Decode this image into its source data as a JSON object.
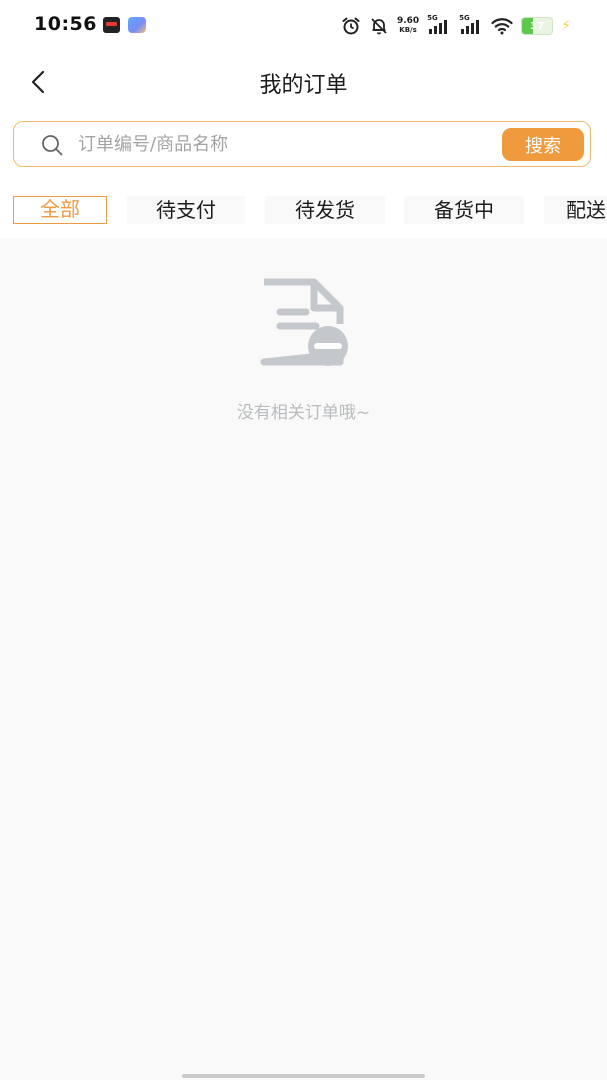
{
  "status_bar": {
    "time": "10:56",
    "net_speed_value": "9.60",
    "net_speed_unit": "KB/s",
    "signal_1_label": "5G",
    "signal_2_label": "5G",
    "battery_level": "37",
    "battery_fraction": 0.37,
    "colors": {
      "battery_fill": "#5cc94a",
      "bolt": "#f0d24a"
    }
  },
  "header": {
    "title": "我的订单"
  },
  "search": {
    "placeholder": "订单编号/商品名称",
    "button_label": "搜索"
  },
  "tabs": [
    {
      "label": "全部",
      "active": true
    },
    {
      "label": "待支付",
      "active": false
    },
    {
      "label": "待发货",
      "active": false
    },
    {
      "label": "备货中",
      "active": false
    },
    {
      "label": "配送中",
      "active": false
    }
  ],
  "empty_state": {
    "icon": "document-remove-icon",
    "message": "没有相关订单哦~"
  },
  "colors": {
    "accent": "#f09a3e",
    "accent_border": "#efb86e",
    "background": "#f8f9f8",
    "empty_text": "#b9bcbf"
  }
}
